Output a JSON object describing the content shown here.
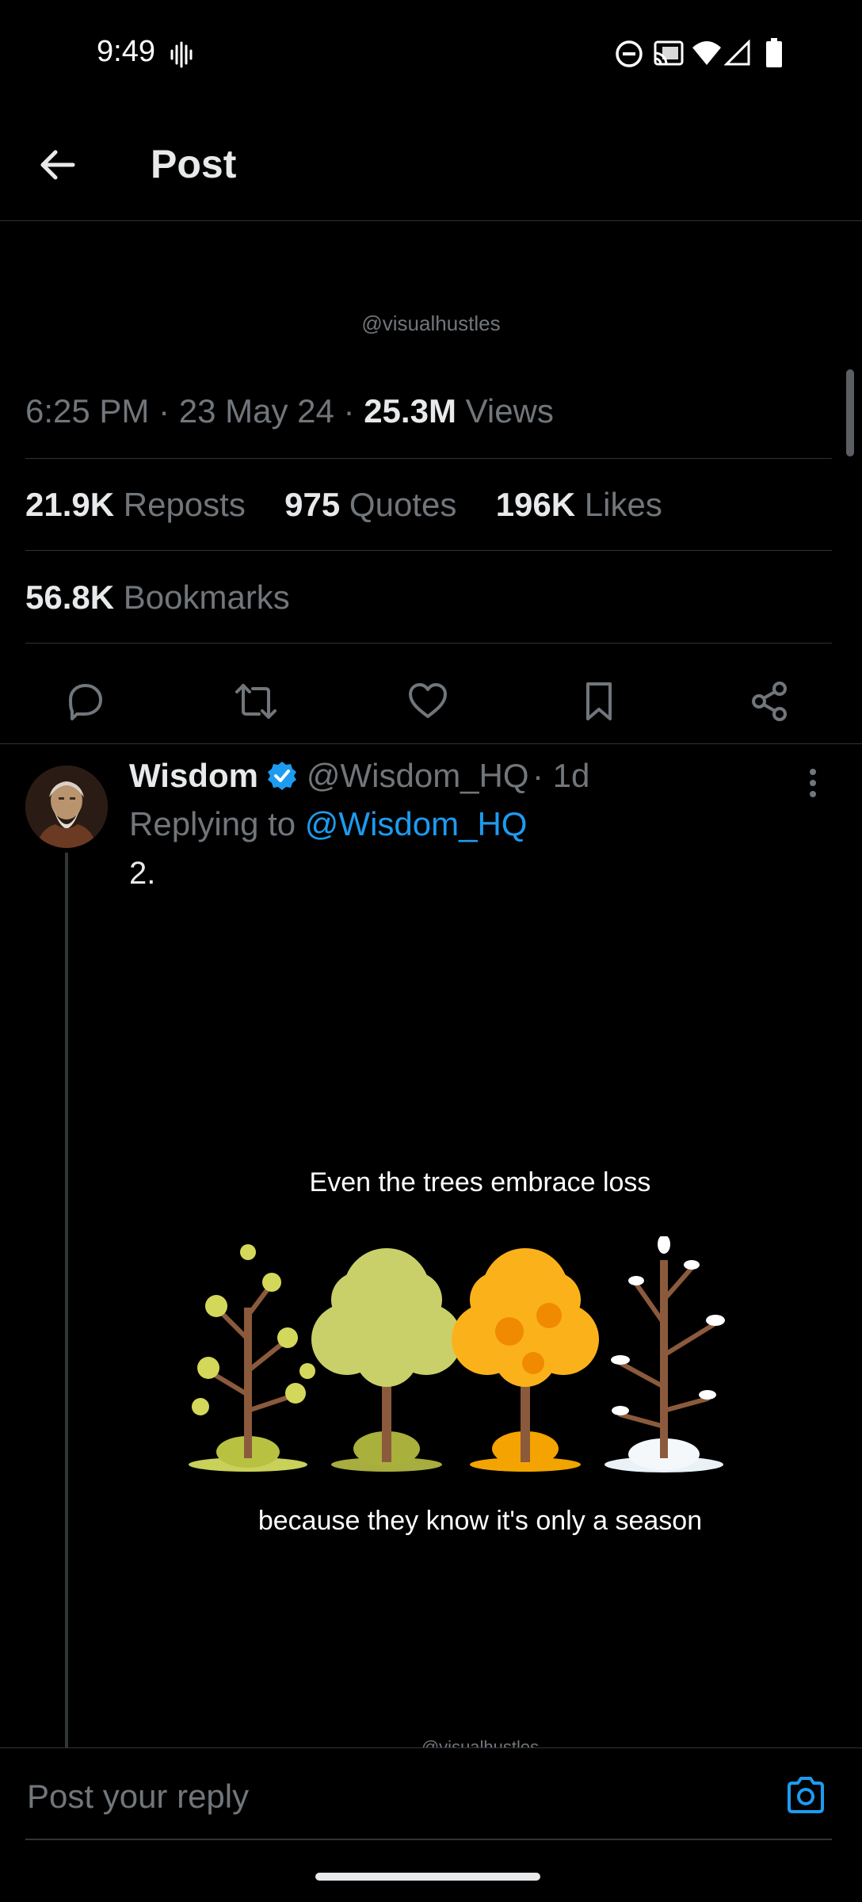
{
  "status_bar": {
    "time": "9:49",
    "icons": [
      "vibrate-icon",
      "do-not-disturb-icon",
      "cast-icon",
      "wifi-icon",
      "cellular-signal-icon",
      "battery-icon"
    ]
  },
  "header": {
    "title": "Post",
    "back_icon": "arrow-left-icon"
  },
  "post": {
    "image_watermark": "@visualhustles",
    "time": "6:25 PM",
    "date": "23 May 24",
    "views_count": "25.3M",
    "views_label": "Views",
    "reposts_count": "21.9K",
    "reposts_label": "Reposts",
    "quotes_count": "975",
    "quotes_label": "Quotes",
    "likes_count": "196K",
    "likes_label": "Likes",
    "bookmarks_count": "56.8K",
    "bookmarks_label": "Bookmarks",
    "actions": [
      "reply-icon",
      "repost-icon",
      "like-icon",
      "bookmark-icon",
      "share-icon"
    ]
  },
  "reply_tweet": {
    "author_name": "Wisdom",
    "verified": true,
    "handle": "@Wisdom_HQ",
    "age": "1d",
    "replying_prefix": "Replying to",
    "replying_to": "@Wisdom_HQ",
    "text": "2.",
    "media": {
      "caption_top": "Even the trees embrace loss",
      "caption_bottom": "because they know it's only a season",
      "watermark": "@visualhustles"
    }
  },
  "reply_bar": {
    "placeholder": "Post your reply",
    "camera_icon": "camera-icon"
  },
  "colors": {
    "background": "#000000",
    "text": "#e7e9ea",
    "secondary": "#71767b",
    "accent": "#1d9bf0",
    "divider": "#2f3336"
  }
}
